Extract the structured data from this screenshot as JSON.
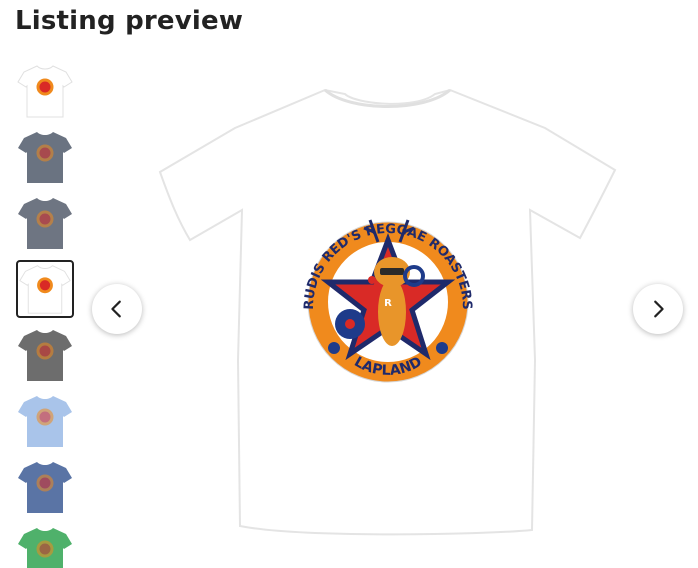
{
  "page": {
    "title": "Listing preview"
  },
  "gallery": {
    "selected_index": 3,
    "thumbnails": [
      {
        "shirt_color": "#ffffff",
        "label": "white"
      },
      {
        "shirt_color": "#6a7381",
        "label": "slate"
      },
      {
        "shirt_color": "#6e7582",
        "label": "gray-blue"
      },
      {
        "shirt_color": "#ffffff",
        "label": "white"
      },
      {
        "shirt_color": "#6d6d6d",
        "label": "charcoal"
      },
      {
        "shirt_color": "#a9c4ea",
        "label": "light-blue"
      },
      {
        "shirt_color": "#5a74a5",
        "label": "blue"
      },
      {
        "shirt_color": "#4fb16b",
        "label": "green"
      }
    ],
    "main_shirt_color": "#ffffff",
    "prev_icon": "chevron-left-icon",
    "next_icon": "chevron-right-icon"
  },
  "design": {
    "arc_top_text": "RUDIS RED'S REGGAE ROASTERS",
    "arc_bottom_text": "LAPLAND",
    "colors": {
      "ring": "#f08a1d",
      "star": "#1f2a6b",
      "star_inner": "#d92a26",
      "reindeer": "#e8952a",
      "vinyl": "#1e3b8a"
    }
  }
}
